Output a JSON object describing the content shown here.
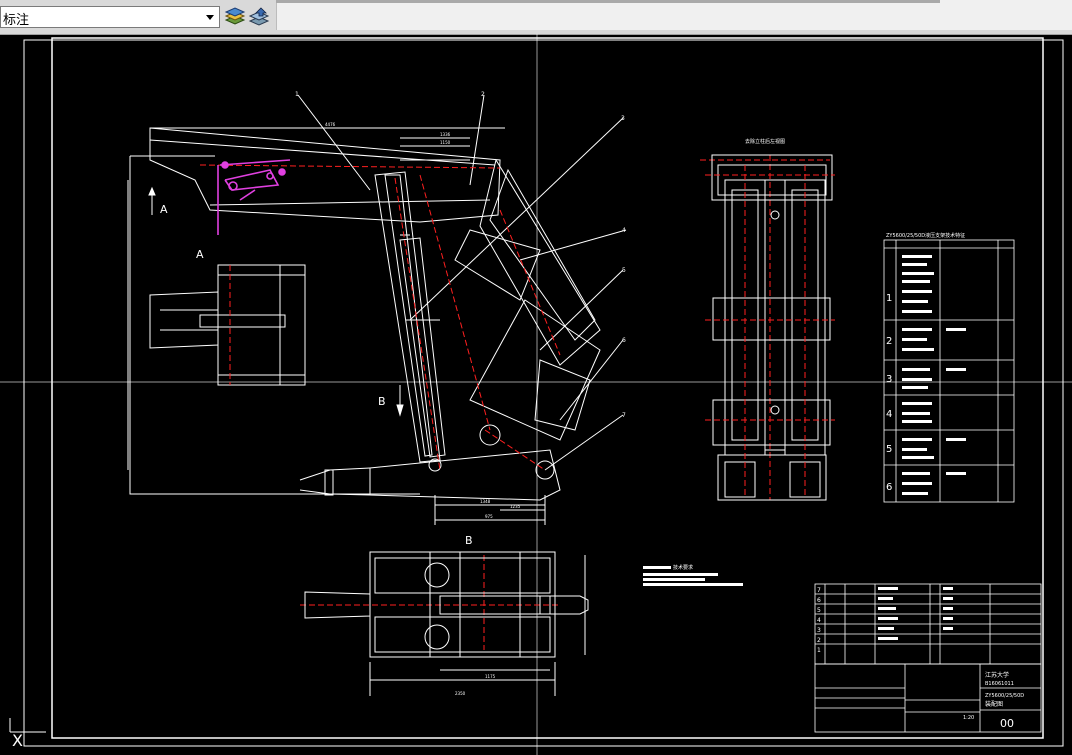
{
  "toolbar": {
    "layer_combo_value": "  标注",
    "layer_combo_icon": "chevron-down-icon",
    "layer_tools": [
      "layers-stack-icon",
      "layer-states-icon"
    ]
  },
  "drawing": {
    "view_label_a_top": "A",
    "view_label_a_left": "A",
    "view_label_b_left": "B",
    "view_label_b_bottom": "B",
    "part_numbers": [
      "1",
      "2",
      "3",
      "4",
      "5",
      "6",
      "7"
    ],
    "side_view_title": "去除立柱后左视图",
    "params_table_title": "ZY5600/25/50D液压支架技术特征",
    "params_row_groups": [
      "1",
      "2",
      "3",
      "4",
      "5",
      "6"
    ],
    "tech_requirements_title": "技术要求",
    "title_block": {
      "school": "江苏大学",
      "student_id": "B16061011",
      "model": "ZY5600/25/50D",
      "drawing_name": "装配图",
      "sheet_number": "00",
      "scale": "1:20"
    },
    "parts_list_seq": [
      "7",
      "6",
      "5",
      "4",
      "3",
      "2",
      "1"
    ],
    "dims": {
      "top_span": "4476",
      "sub_span_1": "1336",
      "sub_span_2": "1150",
      "bottom_1": "1348",
      "bottom_2": "975",
      "bottom_3": "1235",
      "plan_width": "2350",
      "plan_sub": "1175"
    }
  },
  "colors": {
    "background": "#000000",
    "line": "#ffffff",
    "centerline": "#ff2020",
    "highlight": "#e040e0",
    "toolbar_bg": "#d9d9d9"
  }
}
